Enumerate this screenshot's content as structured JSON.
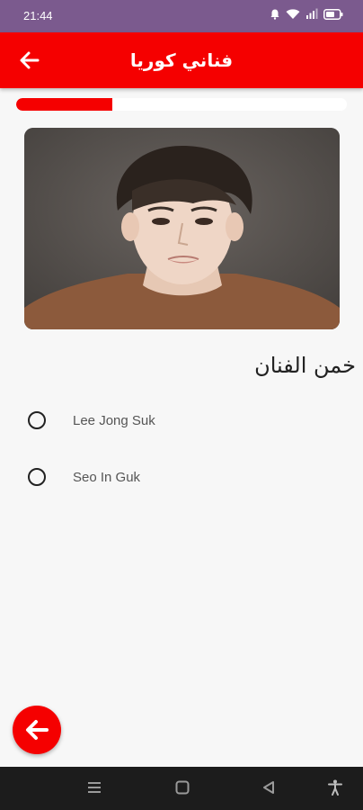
{
  "status_bar": {
    "time": "21:44",
    "icons": [
      "alarm-icon",
      "wifi-icon",
      "signal-icon",
      "battery-icon"
    ]
  },
  "app_bar": {
    "title": "فناني كوريا",
    "back_icon": "arrow-left-icon",
    "color": "#f50000"
  },
  "progress": {
    "fraction": 0.29
  },
  "question": {
    "text": "خمن الفنان"
  },
  "options": [
    {
      "label": "Lee Jong Suk",
      "selected": false
    },
    {
      "label": "Seo In Guk",
      "selected": false
    }
  ],
  "fab": {
    "icon": "arrow-left-icon"
  },
  "nav_bar": {
    "buttons": [
      "menu-icon",
      "home-icon",
      "back-triangle-icon",
      "accessibility-icon"
    ]
  },
  "colors": {
    "status_bar": "#7b5a8e",
    "accent": "#f50000",
    "background": "#f7f7f7"
  }
}
